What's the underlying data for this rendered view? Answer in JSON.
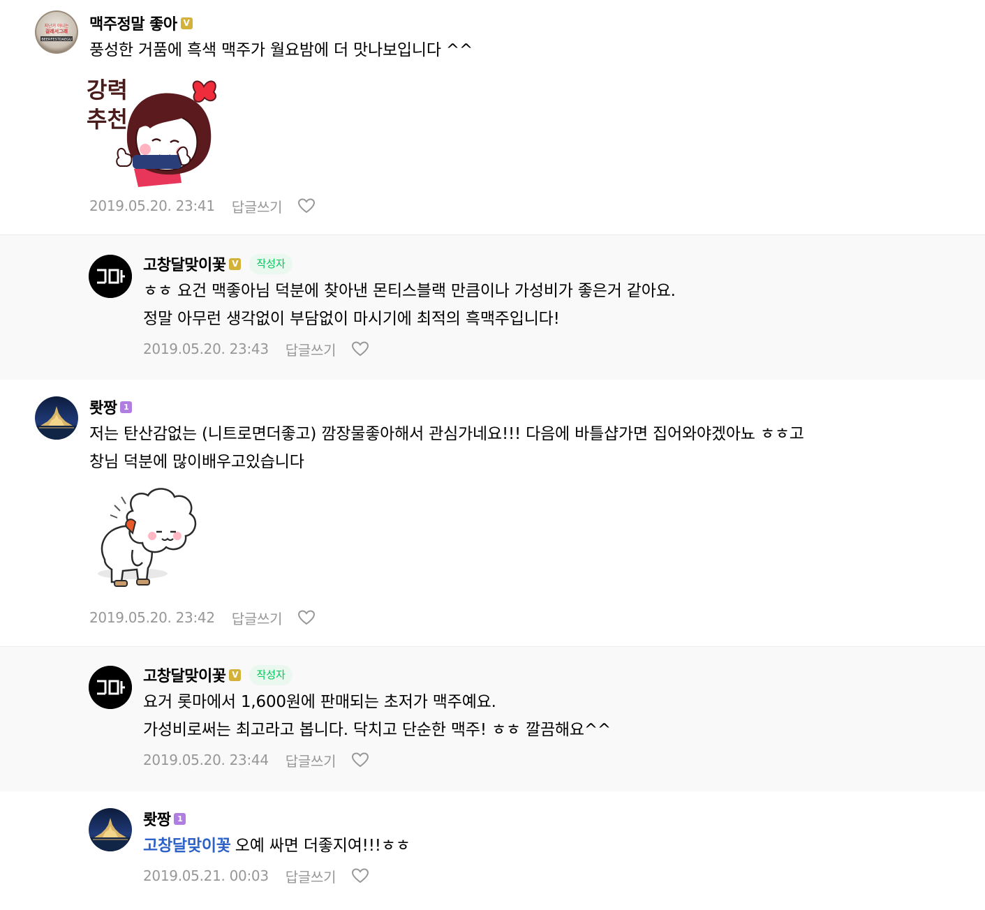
{
  "comments": [
    {
      "nick": "맥주정말 좋아",
      "badge_color": "#d4b23a",
      "lines": [
        "풍성한 거품에 흑색 맥주가 월요밤에 더 맛나보입니다 ^^"
      ],
      "sticker": {
        "name": "girl-thumbs-up-sticker",
        "text_line1": "강력",
        "text_line2": "추천"
      },
      "date": "2019.05.20. 23:41",
      "reply_label": "답글쓰기",
      "avatar_text": {
        "line1": "지난거 아니는",
        "line2": "걸레서그래",
        "line3": "BEERFESTDAEGU"
      }
    },
    {
      "nick": "고창달맞이꽃",
      "badge_color": "#d4b23a",
      "writer_tag": "작성자",
      "lines": [
        "ㅎㅎ 요건 맥좋아님 덕분에 찾아낸 몬티스블랙 만큼이나 가성비가 좋은거 같아요.",
        "정말 아무런 생각없이 부담없이 마시기에 최적의 흑맥주입니다!"
      ],
      "date": "2019.05.20. 23:43",
      "reply_label": "답글쓰기",
      "avatar_text": "ᄀᄃᆞ"
    },
    {
      "nick": "뢋짱",
      "badge_color": "#b07de0",
      "lines": [
        "저는 탄산감없는 (니트로면더좋고) 깜장물좋아해서 관심가네요!!! 다음에 바틀샵가면 집어와야겠아뇨 ㅎㅎ고",
        "창님 덕분에 많이배우고있습니다"
      ],
      "sticker": {
        "name": "sheep-bowing-sticker"
      },
      "date": "2019.05.20. 23:42",
      "reply_label": "답글쓰기"
    },
    {
      "nick": "고창달맞이꽃",
      "badge_color": "#d4b23a",
      "writer_tag": "작성자",
      "lines": [
        "요거 롯마에서 1,600원에 판매되는 초저가 맥주예요.",
        "가성비로써는 최고라고 봅니다. 닥치고 단순한 맥주! ㅎㅎ 깔끔해요^^"
      ],
      "date": "2019.05.20. 23:44",
      "reply_label": "답글쓰기"
    },
    {
      "nick": "뢋짱",
      "badge_color": "#b07de0",
      "mention": "고창달맞이꽃",
      "lines": [
        "오예 싸면 더좋지여!!!ㅎㅎ"
      ],
      "date": "2019.05.21. 00:03",
      "reply_label": "답글쓰기"
    }
  ]
}
